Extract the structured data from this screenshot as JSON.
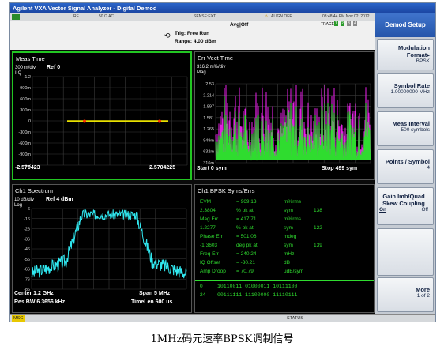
{
  "window": {
    "title": "Agilent VXA Vector Signal Analyzer - Digital Demod"
  },
  "status": {
    "rf": "RF",
    "impedance": "50 Ω AC",
    "sense": "SENSE:EXT",
    "align": "ALIGN OFF",
    "datetime": "03:48:44 PM Nov 02, 2012",
    "trace_label": "TRACE",
    "trace_numbers": [
      "1",
      "2",
      "3",
      "4"
    ]
  },
  "control": {
    "avg": "Avg|Off",
    "trigger": "Trig: Free Run",
    "range": "Range: 4.00 dBm"
  },
  "windows": {
    "meas_time": {
      "title": "Meas Time",
      "scale": "300 m/div",
      "ref": "Ref 0",
      "type": "I-Q",
      "y_ticks": [
        "1.2",
        "900m",
        "600m",
        "300m",
        "0",
        "-300m",
        "-600m",
        "-900m",
        "-1.2"
      ],
      "x_left": "-2.570423",
      "x_right": "2.5704225"
    },
    "err_vect": {
      "title": "Err Vect Time",
      "scale": "316.2 m%/div",
      "type": "Mag",
      "y_ticks": [
        "2.53",
        "2.214",
        "1.897",
        "1.581",
        "1.265",
        "949m",
        "632m",
        "316m"
      ],
      "start": "Start 0   sym",
      "stop": "Stop 499  sym"
    },
    "spectrum": {
      "title": "Ch1 Spectrum",
      "scale": "10 dB/div",
      "ref": "Ref 4 dBm",
      "type": "Log",
      "y_ticks": [
        "-6",
        "-16",
        "-26",
        "-36",
        "-46",
        "-56",
        "-66",
        "-76",
        "-86"
      ],
      "center": "Center 1.2 GHz",
      "span": "Span 5 MHz",
      "res_bw": "Res BW 6.3656 kHz",
      "timelen": "TimeLen 600 us"
    },
    "syms": {
      "title": "Ch1 BPSK Syms/Errs",
      "rows": [
        {
          "label": "EVM",
          "value": "= 969.13",
          "unit": "m%rms",
          "extra": ""
        },
        {
          "label": "2.3804",
          "value": "% pk  at",
          "unit": "sym",
          "extra": "138"
        },
        {
          "label": "Mag Err",
          "value": "= 417.71",
          "unit": "m%rms",
          "extra": ""
        },
        {
          "label": "1.2277",
          "value": "% pk  at",
          "unit": "sym",
          "extra": "122"
        },
        {
          "label": "Phase Err",
          "value": "= 501.06",
          "unit": "mdeg",
          "extra": ""
        },
        {
          "label": "-1.3603",
          "value": "deg  pk  at",
          "unit": "sym",
          "extra": "139"
        },
        {
          "label": "Freq Err",
          "value": "= 240.24",
          "unit": "mHz",
          "extra": ""
        },
        {
          "label": "IQ Offset",
          "value": "= -30.21",
          "unit": "dB",
          "extra": ""
        },
        {
          "label": "Amp Droop",
          "value": "= 70.79",
          "unit": "udB/sym",
          "extra": ""
        }
      ],
      "bits": [
        {
          "index": "0",
          "bits": "10110011  01000011  10111100"
        },
        {
          "index": "24",
          "bits": "00111111  11100000  11110111"
        }
      ]
    }
  },
  "softkeys": {
    "header": "Demod Setup",
    "keys": [
      {
        "label": "Modulation Format",
        "value": "BPSK"
      },
      {
        "label": "Symbol Rate",
        "value": "1.00000000 MHz"
      },
      {
        "label": "Meas Interval",
        "value": "500 symbols"
      },
      {
        "label": "Points / Symbol",
        "value": "4"
      },
      {
        "label": "Gain Imb/Quad Skew Coupling",
        "on": "On",
        "off": "Off"
      },
      {
        "label": "More",
        "value": "1 of 2"
      }
    ]
  },
  "bottom": {
    "msg": "MSG",
    "status": "STATUS"
  },
  "caption": "1MHz码元速率BPSK调制信号",
  "colors": {
    "trace_yellow": "#e8e000",
    "trace_green": "#2fdc2f",
    "trace_magenta": "#e020e0",
    "spectrum_cyan": "#30e8f0"
  }
}
